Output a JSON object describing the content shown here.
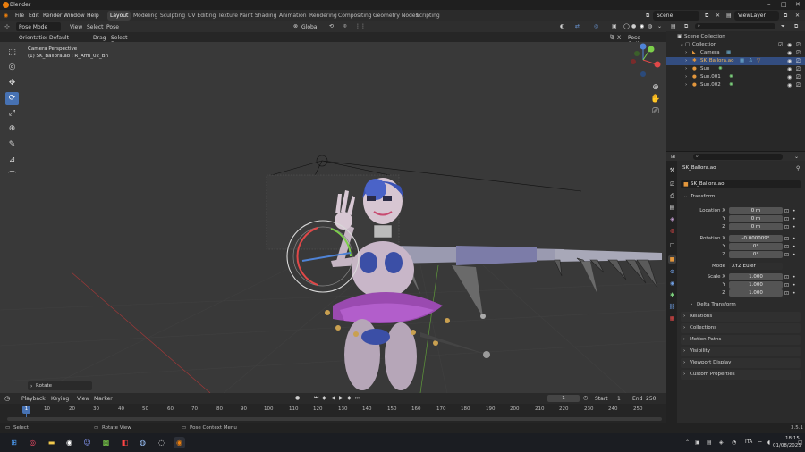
{
  "title_bar": {
    "title": "Blender"
  },
  "menu": {
    "items": [
      "File",
      "Edit",
      "Render",
      "Window",
      "Help"
    ],
    "workspaces": [
      "Layout",
      "Modeling",
      "Sculpting",
      "UV Editing",
      "Texture Paint",
      "Shading",
      "Animation",
      "Rendering",
      "Compositing",
      "Geometry Nodes",
      "Scripting"
    ],
    "active_workspace": "Layout",
    "scene": "Scene",
    "view_layer": "ViewLayer"
  },
  "viewport_header": {
    "mode": "Pose Mode",
    "view": "View",
    "select": "Select",
    "pose": "Pose",
    "transform_orientation": "Global",
    "orientation_label": "Orientation:",
    "orientation_value": "Default",
    "drag_label": "Drag",
    "drag_value": "Select Box",
    "pose_options": "Pose Options",
    "x_axis": "X"
  },
  "viewport": {
    "camera_label": "Camera Perspective",
    "object_info": "(1) SK_Ballora.ao : R_Arm_02_Bn",
    "operator_panel": "Rotate"
  },
  "outliner": {
    "root": "Scene Collection",
    "collection": "Collection",
    "items": [
      {
        "name": "Camera",
        "selected": false
      },
      {
        "name": "SK_Ballora.ao",
        "selected": true
      },
      {
        "name": "Sun",
        "selected": false
      },
      {
        "name": "Sun.001",
        "selected": false
      },
      {
        "name": "Sun.002",
        "selected": false
      }
    ]
  },
  "properties": {
    "object_name": "SK_Ballora.ao",
    "object_field": "SK_Ballora.ao",
    "transform_title": "Transform",
    "location_label": "Location X",
    "location": [
      "0 m",
      "0 m",
      "0 m"
    ],
    "rotation_label": "Rotation X",
    "rotation": [
      "-0.000009°",
      "0°",
      "0°"
    ],
    "mode_label": "Mode",
    "mode_value": "XYZ Euler",
    "scale_label": "Scale X",
    "scale": [
      "1.000",
      "1.000",
      "1.000"
    ],
    "axis_y": "Y",
    "axis_z": "Z",
    "delta_transform": "Delta Transform",
    "sections": [
      "Relations",
      "Collections",
      "Motion Paths",
      "Visibility",
      "Viewport Display",
      "Custom Properties"
    ]
  },
  "timeline": {
    "menus": [
      "Playback",
      "Keying",
      "View",
      "Marker"
    ],
    "current_frame": "1",
    "start_label": "Start",
    "start": "1",
    "end_label": "End",
    "end": "250",
    "ticks": [
      "10",
      "20",
      "30",
      "40",
      "50",
      "60",
      "70",
      "80",
      "90",
      "100",
      "110",
      "120",
      "130",
      "140",
      "150",
      "160",
      "170",
      "180",
      "190",
      "200",
      "210",
      "220",
      "230",
      "240",
      "250"
    ],
    "playhead": "1"
  },
  "status_bar": {
    "select": "Select",
    "rotate_view": "Rotate View",
    "context_menu": "Pose Context Menu",
    "version": "3.5.1"
  },
  "taskbar": {
    "lang": "ITA",
    "time": "18:15",
    "date": "01/08/2025"
  },
  "colors": {
    "accent": "#4772b3",
    "selection": "#334d80",
    "skirt": "#9a4ab0",
    "rotate_x": "#e04848",
    "rotate_y": "#7ccf4a",
    "rotate_z": "#4f83d6"
  }
}
